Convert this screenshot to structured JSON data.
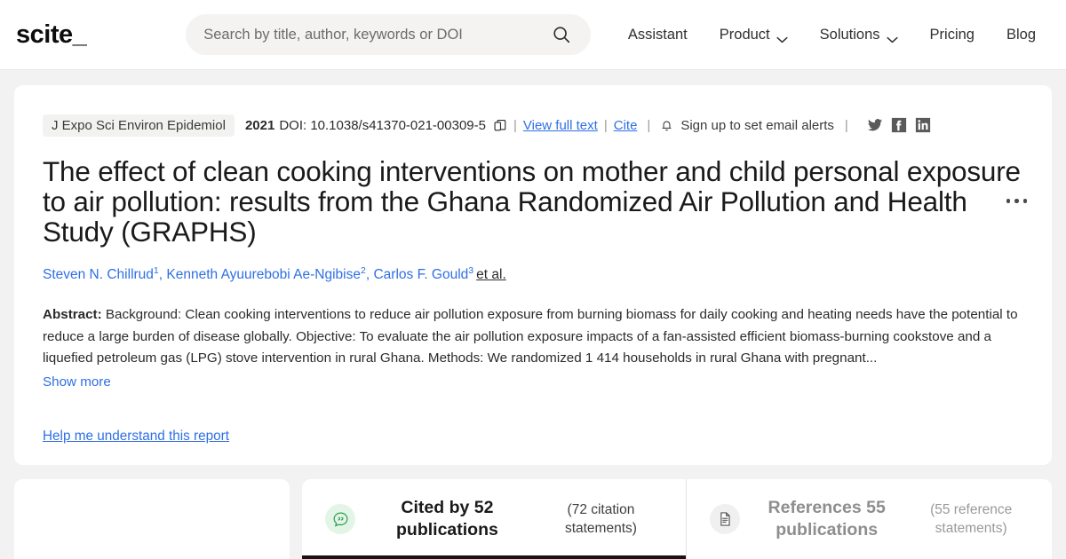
{
  "header": {
    "logo": "scite_",
    "search": {
      "placeholder": "Search by title, author, keywords or DOI",
      "value": "",
      "icon": "search-icon"
    },
    "nav": [
      {
        "label": "Assistant",
        "caret": false
      },
      {
        "label": "Product",
        "caret": true
      },
      {
        "label": "Solutions",
        "caret": true
      },
      {
        "label": "Pricing",
        "caret": false
      },
      {
        "label": "Blog",
        "caret": false
      }
    ]
  },
  "paper": {
    "journal": "J Expo Sci Environ Epidemiol",
    "year": "2021",
    "doi": "DOI: 10.1038/s41370-021-00309-5",
    "copy_icon": "copy-icon",
    "view_full_text": "View full text",
    "cite": "Cite",
    "bell_icon": "bell-icon",
    "email_alerts": "Sign up to set email alerts",
    "social": [
      "twitter-icon",
      "facebook-icon",
      "linkedin-icon"
    ],
    "more_menu": "more-options-icon",
    "title": "The effect of clean cooking interventions on mother and child personal exposure to air pollution: results from the Ghana Randomized Air Pollution and Health Study (GRAPHS)",
    "authors": [
      {
        "name": "Steven N. Chillrud",
        "sup": "1"
      },
      {
        "name": "Kenneth Ayuurebobi Ae-Ngibise",
        "sup": "2"
      },
      {
        "name": "Carlos F. Gould",
        "sup": "3"
      }
    ],
    "et_al": "et al.",
    "abstract_label": "Abstract:",
    "abstract_text": "Background: Clean cooking interventions to reduce air pollution exposure from burning biomass for daily cooking and heating needs have the potential to reduce a large burden of disease globally. Objective: To evaluate the air pollution exposure impacts of a fan-assisted efficient biomass-burning cookstove and a liquefied petroleum gas (LPG) stove intervention in rural Ghana. Methods: We randomized 1 414 households in rural Ghana with pregnant...",
    "show_more": "Show more",
    "help_report": "Help me understand this report"
  },
  "tabs": {
    "cited": {
      "icon": "quote-bubble-icon",
      "title": "Cited by 52 publications",
      "subtitle": "(72 citation statements)",
      "active": true
    },
    "references": {
      "icon": "document-icon",
      "title": "References 55 publications",
      "subtitle": "(55 reference statements)",
      "active": false
    }
  },
  "colors": {
    "link": "#2f6fe4",
    "accent_green": "#2e9e52",
    "page_bg": "#f2f2f2",
    "active_underline": "#141414"
  }
}
